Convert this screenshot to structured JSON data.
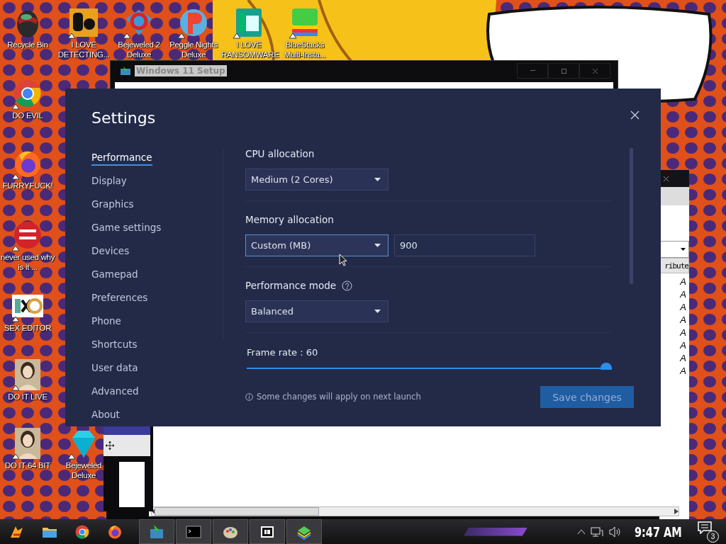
{
  "desktop_icons": [
    {
      "label": "Recycle Bin",
      "kind": "bin",
      "shortcut": false
    },
    {
      "label": "I LOVE DETECTING...",
      "kind": "detect",
      "shortcut": true
    },
    {
      "label": "Bejeweled 2 Deluxe",
      "kind": "gem2",
      "shortcut": true
    },
    {
      "label": "Peggle Nights Deluxe",
      "kind": "peggle",
      "shortcut": true
    },
    {
      "label": "I LOVE RANSOMWARE",
      "kind": "publisher",
      "shortcut": true
    },
    {
      "label": "BlueStacks Multi-Insta...",
      "kind": "stacks",
      "shortcut": true
    },
    {
      "label": "DO EVIL",
      "kind": "chrome",
      "shortcut": true
    },
    {
      "label": "FURRYFUCK!",
      "kind": "firefox",
      "shortcut": true
    },
    {
      "label": "never used why is it ...",
      "kind": "devcpp",
      "shortcut": true
    },
    {
      "label": "SEX EDITOR",
      "kind": "hex",
      "shortcut": true
    },
    {
      "label": "DO IT LIVE",
      "kind": "portrait",
      "shortcut": true
    },
    {
      "label": "DO IT 64 BIT",
      "kind": "portrait",
      "shortcut": true
    },
    {
      "label": "Bejeweled Deluxe",
      "kind": "diamond",
      "shortcut": true
    }
  ],
  "setup_window": {
    "title": "Windows 11 Setup"
  },
  "back_window": {
    "column_header": "ribute",
    "cells": [
      "A",
      "A",
      "A",
      "A",
      "A",
      "A",
      "A",
      "A"
    ]
  },
  "settings": {
    "title": "Settings",
    "nav": [
      {
        "label": "Performance",
        "selected": true
      },
      {
        "label": "Display",
        "selected": false
      },
      {
        "label": "Graphics",
        "selected": false
      },
      {
        "label": "Game settings",
        "selected": false
      },
      {
        "label": "Devices",
        "selected": false
      },
      {
        "label": "Gamepad",
        "selected": false
      },
      {
        "label": "Preferences",
        "selected": false
      },
      {
        "label": "Phone",
        "selected": false
      },
      {
        "label": "Shortcuts",
        "selected": false
      },
      {
        "label": "User data",
        "selected": false
      },
      {
        "label": "Advanced",
        "selected": false
      },
      {
        "label": "About",
        "selected": false
      }
    ],
    "cpu": {
      "label": "CPU allocation",
      "value": "Medium (2 Cores)",
      "focused": false
    },
    "memory": {
      "label": "Memory allocation",
      "value": "Custom (MB)",
      "focused": true,
      "amount": "900"
    },
    "mode": {
      "label": "Performance mode",
      "value": "Balanced",
      "focused": false
    },
    "frame_rate": {
      "label": "Frame rate : 60",
      "level": 1
    },
    "note": "Some changes will apply on next launch",
    "save_button": "Save changes"
  },
  "taskbar": {
    "pinned": [
      {
        "kind": "start"
      },
      {
        "kind": "folder"
      },
      {
        "kind": "chrome"
      },
      {
        "kind": "firefox"
      }
    ],
    "tasks": [
      {
        "kind": "setup"
      },
      {
        "kind": "terminal"
      },
      {
        "kind": "paint"
      },
      {
        "kind": "zip"
      },
      {
        "kind": "stacks"
      }
    ],
    "clock": "9:47 AM",
    "notification_count": "3"
  }
}
